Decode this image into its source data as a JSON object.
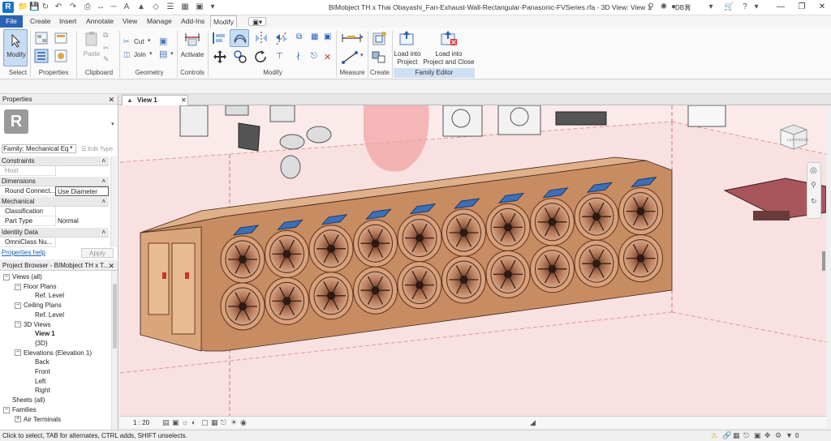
{
  "window": {
    "title": "BIMobject TH x Thai Obayashi_Fan-Exhaust-Wall-Rectangular-Panasonic-FVSeries.rfa - 3D View: View 1",
    "user": "DB賞",
    "app_icon": "R"
  },
  "menu": {
    "tabs": [
      "File",
      "Create",
      "Insert",
      "Annotate",
      "View",
      "Manage",
      "Add-Ins",
      "Modify"
    ],
    "active": "Modify"
  },
  "ribbon": {
    "modify_label": "Modify",
    "select_label": "Select",
    "properties_label": "Properties",
    "paste_label": "Paste",
    "clipboard_label": "Clipboard",
    "cut_label": "Cut",
    "join_label": "Join",
    "geometry_label": "Geometry",
    "activate_label": "Activate",
    "controls_label": "Controls",
    "modify_panel_label": "Modify",
    "measure_label": "Measure",
    "create_label": "Create",
    "load_into_project_label": "Load into\nProject",
    "load_into_project_close_label": "Load into\nProject and Close",
    "family_editor_label": "Family Editor"
  },
  "properties": {
    "header": "Properties",
    "type_icon": "R",
    "family_selector": "Family: Mechanical Eq",
    "edit_type": "Edit Type",
    "groups": [
      {
        "name": "Constraints",
        "rows": [
          {
            "k": "Host",
            "v": ""
          }
        ]
      },
      {
        "name": "Dimensions",
        "rows": [
          {
            "k": "Round Connect...",
            "v": "Use Diameter"
          }
        ]
      },
      {
        "name": "Mechanical",
        "rows": [
          {
            "k": "Classification",
            "v": ""
          },
          {
            "k": "Part Type",
            "v": "Normal"
          }
        ]
      },
      {
        "name": "Identity Data",
        "rows": [
          {
            "k": "OmniClass Nu...",
            "v": ""
          }
        ]
      }
    ],
    "help_link": "Properties help",
    "apply_label": "Apply"
  },
  "browser": {
    "header": "Project Browser - BIMobject TH x T...",
    "items": [
      {
        "label": "Views (all)",
        "indent": 0,
        "expander": "−",
        "bold": false
      },
      {
        "label": "Floor Plans",
        "indent": 1,
        "expander": "−",
        "bold": false
      },
      {
        "label": "Ref. Level",
        "indent": 2,
        "expander": "",
        "bold": false
      },
      {
        "label": "Ceiling Plans",
        "indent": 1,
        "expander": "−",
        "bold": false
      },
      {
        "label": "Ref. Level",
        "indent": 2,
        "expander": "",
        "bold": false
      },
      {
        "label": "3D Views",
        "indent": 1,
        "expander": "−",
        "bold": false
      },
      {
        "label": "View 1",
        "indent": 2,
        "expander": "",
        "bold": true
      },
      {
        "label": "{3D}",
        "indent": 2,
        "expander": "",
        "bold": false
      },
      {
        "label": "Elevations (Elevation 1)",
        "indent": 1,
        "expander": "−",
        "bold": false
      },
      {
        "label": "Back",
        "indent": 2,
        "expander": "",
        "bold": false
      },
      {
        "label": "Front",
        "indent": 2,
        "expander": "",
        "bold": false
      },
      {
        "label": "Left",
        "indent": 2,
        "expander": "",
        "bold": false
      },
      {
        "label": "Right",
        "indent": 2,
        "expander": "",
        "bold": false
      },
      {
        "label": "Sheets (all)",
        "indent": 0,
        "expander": "",
        "bold": false
      },
      {
        "label": "Families",
        "indent": 0,
        "expander": "−",
        "bold": false
      },
      {
        "label": "Air Terminals",
        "indent": 1,
        "expander": "+",
        "bold": false
      }
    ]
  },
  "view": {
    "tab_label": "View 1",
    "scale": "1 : 20",
    "viewcube_face_left": "LEFT",
    "viewcube_face_front": "FRONT"
  },
  "status": {
    "text": "Click to select, TAB for alternates, CTRL adds, SHIFT unselects.",
    "filter_count": "0"
  },
  "colors": {
    "accent": "#2b63b5",
    "housing": "#d29a6e",
    "housing_dark": "#a8683f",
    "room_tint": "#f8dede"
  }
}
